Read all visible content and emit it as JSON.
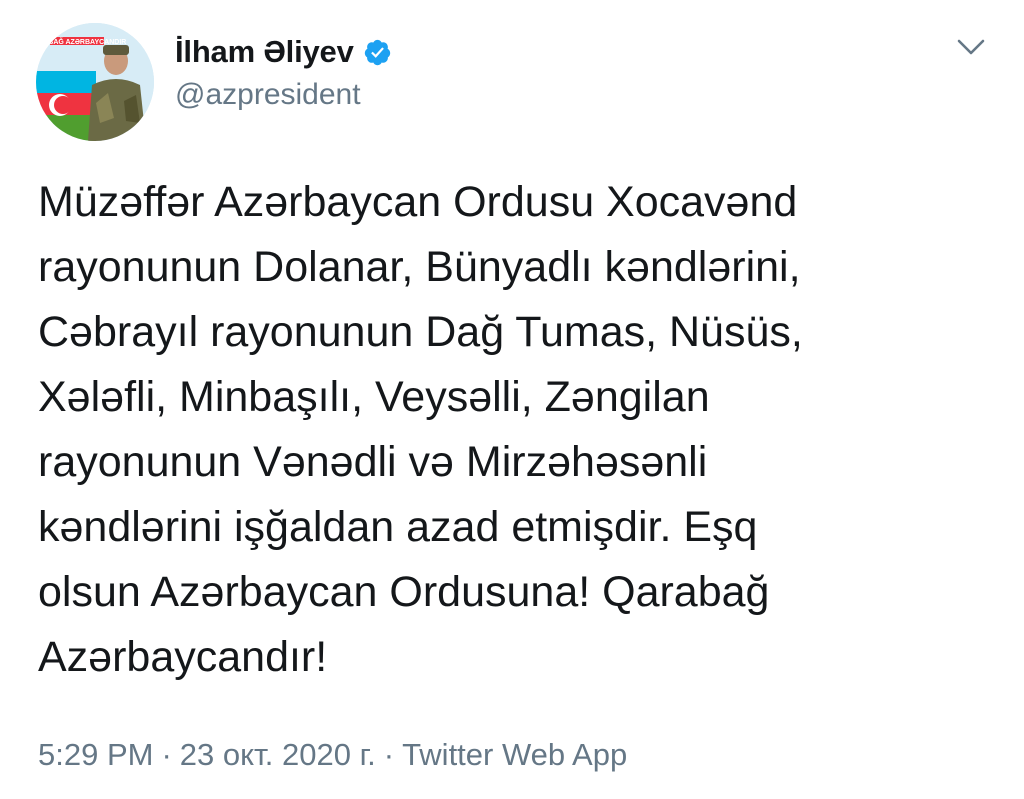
{
  "tweet": {
    "author": {
      "display_name": "İlham Əliyev",
      "handle": "@azpresident",
      "verified": true,
      "avatar_text": "QARABAĞ AZƏRBAYCANDIR"
    },
    "text_lines": [
      "Müzəffər Azərbaycan Ordusu Xocavənd",
      "rayonunun Dolanar, Bünyadlı kəndlərini,",
      "Cəbrayıl rayonunun Dağ Tumas, Nüsüs,",
      "Xələfli, Minbaşılı, Veysəlli, Zəngilan",
      "rayonunun Vənədli və Mirzəhəsənli",
      "kəndlərini işğaldan azad etmişdir. Eşq",
      "olsun Azərbaycan Ordusuna! Qarabağ",
      "Azərbaycandır!"
    ],
    "time": "5:29 PM",
    "date": "23 окт. 2020 г.",
    "source": "Twitter Web App",
    "separator": "·"
  },
  "icons": {
    "verified": "verified-badge-icon",
    "menu": "chevron-down-icon"
  },
  "colors": {
    "verified_blue": "#1da1f2",
    "secondary_text": "#657786",
    "primary_text": "#14171a"
  }
}
